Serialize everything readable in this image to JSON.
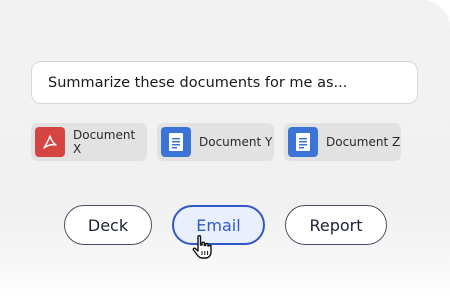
{
  "prompt": {
    "text": "Summarize these documents for me as..."
  },
  "documents": [
    {
      "label": "Document X",
      "icon": "pdf-icon",
      "color": "#d64541"
    },
    {
      "label": "Document Y",
      "icon": "google-doc-icon",
      "color": "#3b74d6"
    },
    {
      "label": "Document Z",
      "icon": "google-doc-icon",
      "color": "#3b74d6"
    }
  ],
  "formats": {
    "deck": "Deck",
    "email": "Email",
    "report": "Report",
    "selected": "Email"
  },
  "colors": {
    "accent": "#2f58c8",
    "selected_bg": "#eaf0fb",
    "button_border": "#4a4f63"
  }
}
